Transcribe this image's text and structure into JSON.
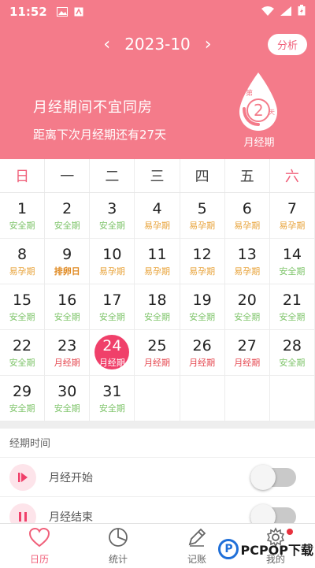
{
  "status_bar": {
    "time": "11:52"
  },
  "header": {
    "prev_arrow": "‹",
    "next_arrow": "›",
    "month": "2023-10",
    "analyze_label": "分析",
    "headline": "月经期间不宜同房",
    "countdown": "距离下次月经期还有27天",
    "drop_prefix": "第",
    "drop_day": "2",
    "drop_suffix": "天",
    "drop_label": "月经期"
  },
  "calendar": {
    "weekdays": [
      "日",
      "一",
      "二",
      "三",
      "四",
      "五",
      "六"
    ],
    "days": [
      {
        "d": "1",
        "s": "安全期",
        "t": "safe"
      },
      {
        "d": "2",
        "s": "安全期",
        "t": "safe"
      },
      {
        "d": "3",
        "s": "安全期",
        "t": "safe"
      },
      {
        "d": "4",
        "s": "易孕期",
        "t": "fertile"
      },
      {
        "d": "5",
        "s": "易孕期",
        "t": "fertile"
      },
      {
        "d": "6",
        "s": "易孕期",
        "t": "fertile"
      },
      {
        "d": "7",
        "s": "易孕期",
        "t": "fertile"
      },
      {
        "d": "8",
        "s": "易孕期",
        "t": "fertile"
      },
      {
        "d": "9",
        "s": "排卵日",
        "t": "ovul"
      },
      {
        "d": "10",
        "s": "易孕期",
        "t": "fertile"
      },
      {
        "d": "11",
        "s": "易孕期",
        "t": "fertile"
      },
      {
        "d": "12",
        "s": "易孕期",
        "t": "fertile"
      },
      {
        "d": "13",
        "s": "易孕期",
        "t": "fertile"
      },
      {
        "d": "14",
        "s": "安全期",
        "t": "safe"
      },
      {
        "d": "15",
        "s": "安全期",
        "t": "safe"
      },
      {
        "d": "16",
        "s": "安全期",
        "t": "safe"
      },
      {
        "d": "17",
        "s": "安全期",
        "t": "safe"
      },
      {
        "d": "18",
        "s": "安全期",
        "t": "safe"
      },
      {
        "d": "19",
        "s": "安全期",
        "t": "safe"
      },
      {
        "d": "20",
        "s": "安全期",
        "t": "safe"
      },
      {
        "d": "21",
        "s": "安全期",
        "t": "safe"
      },
      {
        "d": "22",
        "s": "安全期",
        "t": "safe"
      },
      {
        "d": "23",
        "s": "月经期",
        "t": "period"
      },
      {
        "d": "24",
        "s": "月经期",
        "t": "period",
        "today": true
      },
      {
        "d": "25",
        "s": "月经期",
        "t": "period"
      },
      {
        "d": "26",
        "s": "月经期",
        "t": "period"
      },
      {
        "d": "27",
        "s": "月经期",
        "t": "period"
      },
      {
        "d": "28",
        "s": "安全期",
        "t": "safe"
      },
      {
        "d": "29",
        "s": "安全期",
        "t": "safe"
      },
      {
        "d": "30",
        "s": "安全期",
        "t": "safe"
      },
      {
        "d": "31",
        "s": "安全期",
        "t": "safe"
      }
    ]
  },
  "period_section": {
    "title": "经期时间",
    "start_label": "月经开始",
    "end_label": "月经结束"
  },
  "tabbar": {
    "calendar": "日历",
    "stats": "统计",
    "notes": "记账",
    "mine": "我的"
  },
  "watermark": {
    "text": "PCPOP下载"
  },
  "colors": {
    "brand": "#f47b8a",
    "accent": "#f0406a",
    "safe": "#7ec46a",
    "fertile": "#e8a43c",
    "period": "#e5474f"
  }
}
